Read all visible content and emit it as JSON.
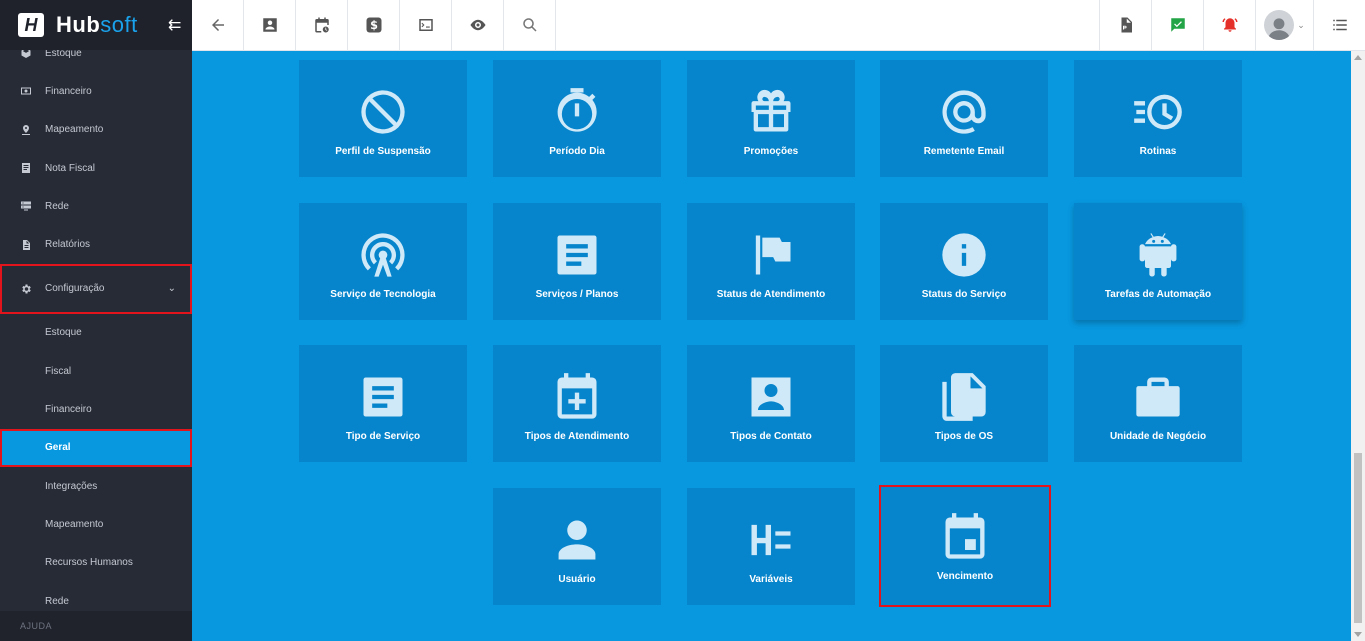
{
  "brand": {
    "name_a": "Hub",
    "name_b": "soft",
    "collapse_icon": "collapse-left-icon"
  },
  "sidebar": {
    "items": [
      {
        "label": "Estoque",
        "icon": "box-icon"
      },
      {
        "label": "Financeiro",
        "icon": "money-icon"
      },
      {
        "label": "Mapeamento",
        "icon": "map-pin-icon"
      },
      {
        "label": "Nota Fiscal",
        "icon": "invoice-icon"
      },
      {
        "label": "Rede",
        "icon": "server-icon"
      },
      {
        "label": "Relatórios",
        "icon": "report-icon"
      },
      {
        "label": "Configuração",
        "icon": "gear-icon"
      }
    ],
    "subitems": [
      {
        "label": "Estoque"
      },
      {
        "label": "Fiscal"
      },
      {
        "label": "Financeiro"
      },
      {
        "label": "Geral"
      },
      {
        "label": "Integrações"
      },
      {
        "label": "Mapeamento"
      },
      {
        "label": "Recursos Humanos"
      },
      {
        "label": "Rede"
      }
    ],
    "section_label": "AJUDA"
  },
  "cards": [
    {
      "label": "Perfil de Suspensão",
      "icon": "block-icon"
    },
    {
      "label": "Período Dia",
      "icon": "timer-icon"
    },
    {
      "label": "Promoções",
      "icon": "gift-icon"
    },
    {
      "label": "Remetente Email",
      "icon": "at-sign-icon"
    },
    {
      "label": "Rotinas",
      "icon": "history-fast-icon"
    },
    {
      "label": "Serviço de Tecnologia",
      "icon": "antenna-icon"
    },
    {
      "label": "Serviços / Planos",
      "icon": "document-icon"
    },
    {
      "label": "Status de Atendimento",
      "icon": "flag-icon"
    },
    {
      "label": "Status do Serviço",
      "icon": "info-icon"
    },
    {
      "label": "Tarefas de Automação",
      "icon": "android-icon"
    },
    {
      "label": "Tipo de Serviço",
      "icon": "list-doc-icon"
    },
    {
      "label": "Tipos de Atendimento",
      "icon": "calendar-add-icon"
    },
    {
      "label": "Tipos de Contato",
      "icon": "contact-card-icon"
    },
    {
      "label": "Tipos de OS",
      "icon": "files-icon"
    },
    {
      "label": "Unidade de Negócio",
      "icon": "briefcase-icon"
    },
    {
      "label": "Usuário",
      "icon": "user-icon"
    },
    {
      "label": "Variáveis",
      "icon": "variables-icon"
    },
    {
      "label": "Vencimento",
      "icon": "calendar-today-icon"
    }
  ],
  "colors": {
    "accent": "#0898e0",
    "card": "#0785cc",
    "sidebar": "#272b35",
    "highlight": "#e3141b"
  }
}
